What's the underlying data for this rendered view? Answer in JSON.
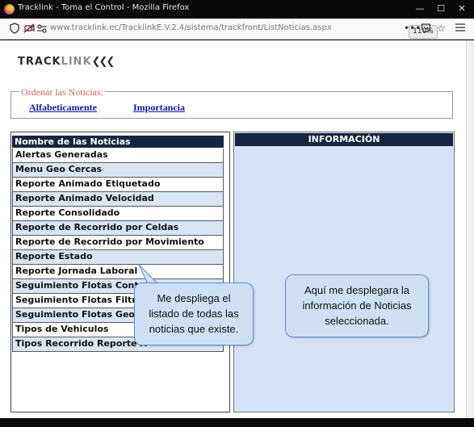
{
  "browser": {
    "window_title": "Tracklink - Toma el Control - Mozilla Firefox",
    "url": "www.tracklink.ec/TracklinkE.V.2.4/sistema/trackfront/ListNoticias.aspx",
    "zoom": "110%",
    "controls": {
      "minimize": "—",
      "maximize": "☐",
      "close": "✕"
    }
  },
  "logo": {
    "part1": "TRACK",
    "part2": "LINK",
    "chevrons": "❮❮❮"
  },
  "sort": {
    "legend": "Ordenar las Noticias:",
    "alphabetic": "Alfabeticamente",
    "importance": "Importancia"
  },
  "list": {
    "header": "Nombre de las Noticias",
    "items": [
      "Alertas Generadas",
      "Menu Geo Cercas",
      "Reporte Animado Etiquetado",
      "Reporte Animado Velocidad",
      "Reporte Consolidado",
      "Reporte de Recorrido por Celdas",
      "Reporte de Recorrido por Movimiento",
      "Reporte Estado",
      "Reporte Jornada Laboral",
      "Seguimiento Flotas Control",
      "Seguimiento Flotas Filtro",
      "Seguimiento Flotas Geo C",
      "Tipos de Vehiculos",
      "Tipos Recorrido Reporte A"
    ]
  },
  "info": {
    "header": "INFORMACIÓN"
  },
  "callouts": {
    "left": [
      "Me despliega el",
      "listado de todas las",
      "noticias que existe."
    ],
    "right": [
      "Aquí me desplegara la",
      "información de Noticias",
      "seleccionada."
    ]
  },
  "icons": {
    "shield": "shield-icon",
    "no-camera": "camera-blocked-icon",
    "permissions": "permissions-icon",
    "more": "more-icon",
    "pocket": "pocket-icon",
    "bookmark": "star-icon"
  }
}
